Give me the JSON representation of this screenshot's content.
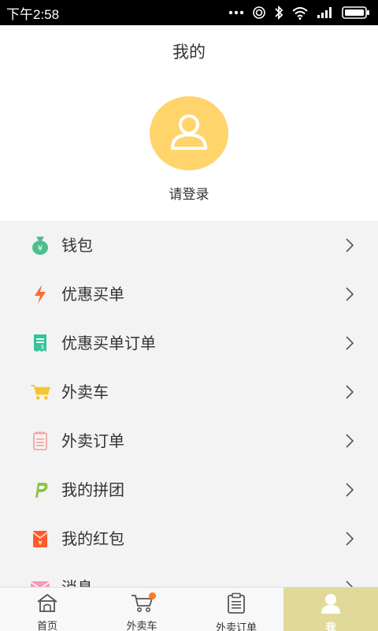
{
  "status_bar": {
    "time": "下午2:58",
    "icons": [
      "dots-icon",
      "hotspot-icon",
      "bluetooth-icon",
      "wifi-icon",
      "signal-icon",
      "battery-icon"
    ]
  },
  "header": {
    "title": "我的"
  },
  "profile": {
    "avatar_icon": "user-icon",
    "login_label": "请登录",
    "avatar_color": "#ffd46b"
  },
  "menu": {
    "items": [
      {
        "label": "钱包",
        "icon": "money-bag-icon",
        "color": "#4cbf8c"
      },
      {
        "label": "优惠买单",
        "icon": "lightning-icon",
        "color": "#ff6a2b"
      },
      {
        "label": "优惠买单订单",
        "icon": "receipt-icon",
        "color": "#36c29a"
      },
      {
        "label": "外卖车",
        "icon": "cart-icon",
        "color": "#f5c431"
      },
      {
        "label": "外卖订单",
        "icon": "order-list-icon",
        "color": "#f29a9a"
      },
      {
        "label": "我的拼团",
        "icon": "group-buy-icon",
        "color": "#8cc63f"
      },
      {
        "label": "我的红包",
        "icon": "red-packet-icon",
        "color": "#ff5a2a"
      },
      {
        "label": "消息",
        "icon": "message-icon",
        "color": "#f59ab8"
      }
    ]
  },
  "tab_bar": {
    "tabs": [
      {
        "label": "首页",
        "icon": "home-icon"
      },
      {
        "label": "外卖车",
        "icon": "cart-icon"
      },
      {
        "label": "外卖订单",
        "icon": "clipboard-icon"
      },
      {
        "label": "我",
        "icon": "user-icon"
      }
    ],
    "active_color": "#e1d99a"
  }
}
